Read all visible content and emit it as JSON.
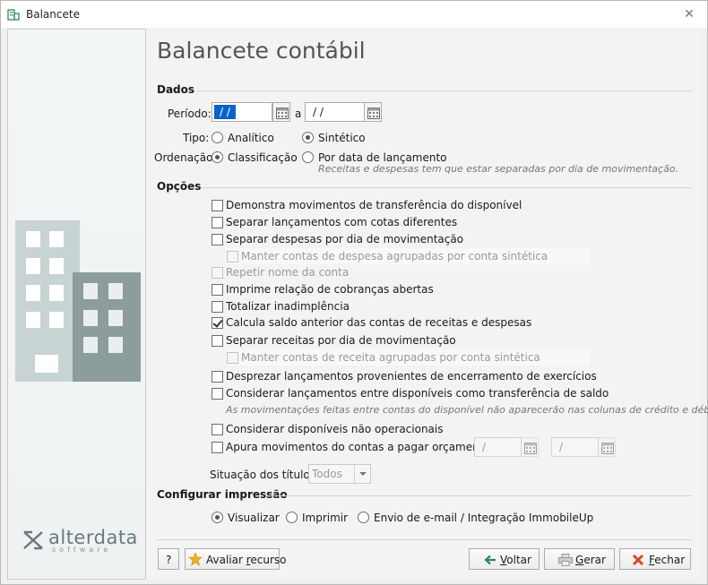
{
  "window": {
    "title": "Balancete",
    "close_glyph": "✕"
  },
  "page_title": "Balancete contábil",
  "dados": {
    "section": "Dados",
    "periodo_label": "Período:",
    "date_from": "/ /",
    "sep": "a",
    "date_to": "/ /",
    "tipo_label": "Tipo:",
    "tipo_analitico": "Analítico",
    "tipo_sintetico": "Sintético",
    "ordenacao_label": "Ordenação:",
    "ord_classificacao": "Classificação",
    "ord_data": "Por data de lançamento",
    "ord_hint": "Receitas e despesas tem que estar separadas por dia de movimentação."
  },
  "opcoes": {
    "section": "Opções",
    "o1": "Demonstra movimentos de transferência do disponível",
    "o2": "Separar lançamentos com cotas diferentes",
    "o3": "Separar despesas por dia de movimentação",
    "o3a": "Manter contas de despesa agrupadas por conta sintética",
    "o4": "Repetir nome da conta",
    "o5": "Imprime relação de cobranças abertas",
    "o6": "Totalizar inadimplência",
    "o7": "Calcula saldo anterior das contas de receitas e despesas",
    "o8": "Separar receitas por dia de movimentação",
    "o8a": "Manter contas de receita agrupadas por conta sintética",
    "o9": "Desprezar lançamentos provenientes de encerramento de exercícios",
    "o10": "Considerar lançamentos entre disponíveis como transferência de saldo",
    "o10_hint": "As movimentações feitas entre contas do disponível não aparecerão nas colunas de crédito e débito",
    "o11": "Considerar disponíveis não operacionais",
    "o12": "Apura movimentos do contas a pagar orçamentário",
    "o12_from": "/",
    "o12_to": "/",
    "situacao_label": "Situação dos títulos",
    "situacao_value": "Todos"
  },
  "impressao": {
    "section": "Configurar impressão",
    "visualizar": "Visualizar",
    "imprimir": "Imprimir",
    "email": "Envio de e-mail / Integração ImmobileUp"
  },
  "footer": {
    "help": "?",
    "avaliar_pre": "Avaliar ",
    "avaliar_u": "r",
    "avaliar_post": "ecurso",
    "voltar_u": "V",
    "voltar_post": "oltar",
    "gerar_u": "G",
    "gerar_post": "erar",
    "fechar_u": "F",
    "fechar_post": "echar"
  },
  "logo": {
    "brand": "alterdata",
    "sub": "software"
  },
  "colors": {
    "accent": "#0a64c8",
    "building": "#bcc9c9",
    "building_dark": "#8a9a9a",
    "close_red": "#d9472b",
    "star": "#f2b01e",
    "arrow_green": "#2e8b57"
  }
}
